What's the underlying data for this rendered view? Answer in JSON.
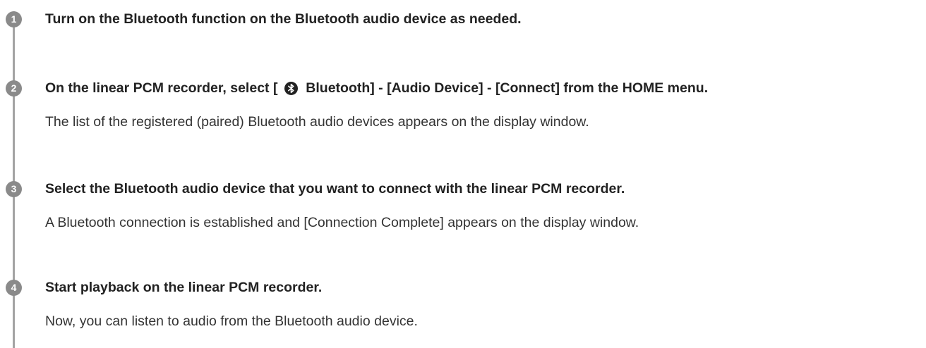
{
  "steps": [
    {
      "number": "1",
      "title": "Turn on the Bluetooth function on the Bluetooth audio device as needed."
    },
    {
      "number": "2",
      "title_prefix": "On the linear PCM recorder, select [",
      "title_suffix": "Bluetooth] - [Audio Device] - [Connect] from the HOME menu.",
      "icon": "bluetooth-icon",
      "body": "The list of the registered (paired) Bluetooth audio devices appears on the display window."
    },
    {
      "number": "3",
      "title": "Select the Bluetooth audio device that you want to connect with the linear PCM recorder.",
      "body": "A Bluetooth connection is established and [Connection Complete] appears on the display window."
    },
    {
      "number": "4",
      "title": "Start playback on the linear PCM recorder.",
      "body": "Now, you can listen to audio from the Bluetooth audio device."
    }
  ]
}
